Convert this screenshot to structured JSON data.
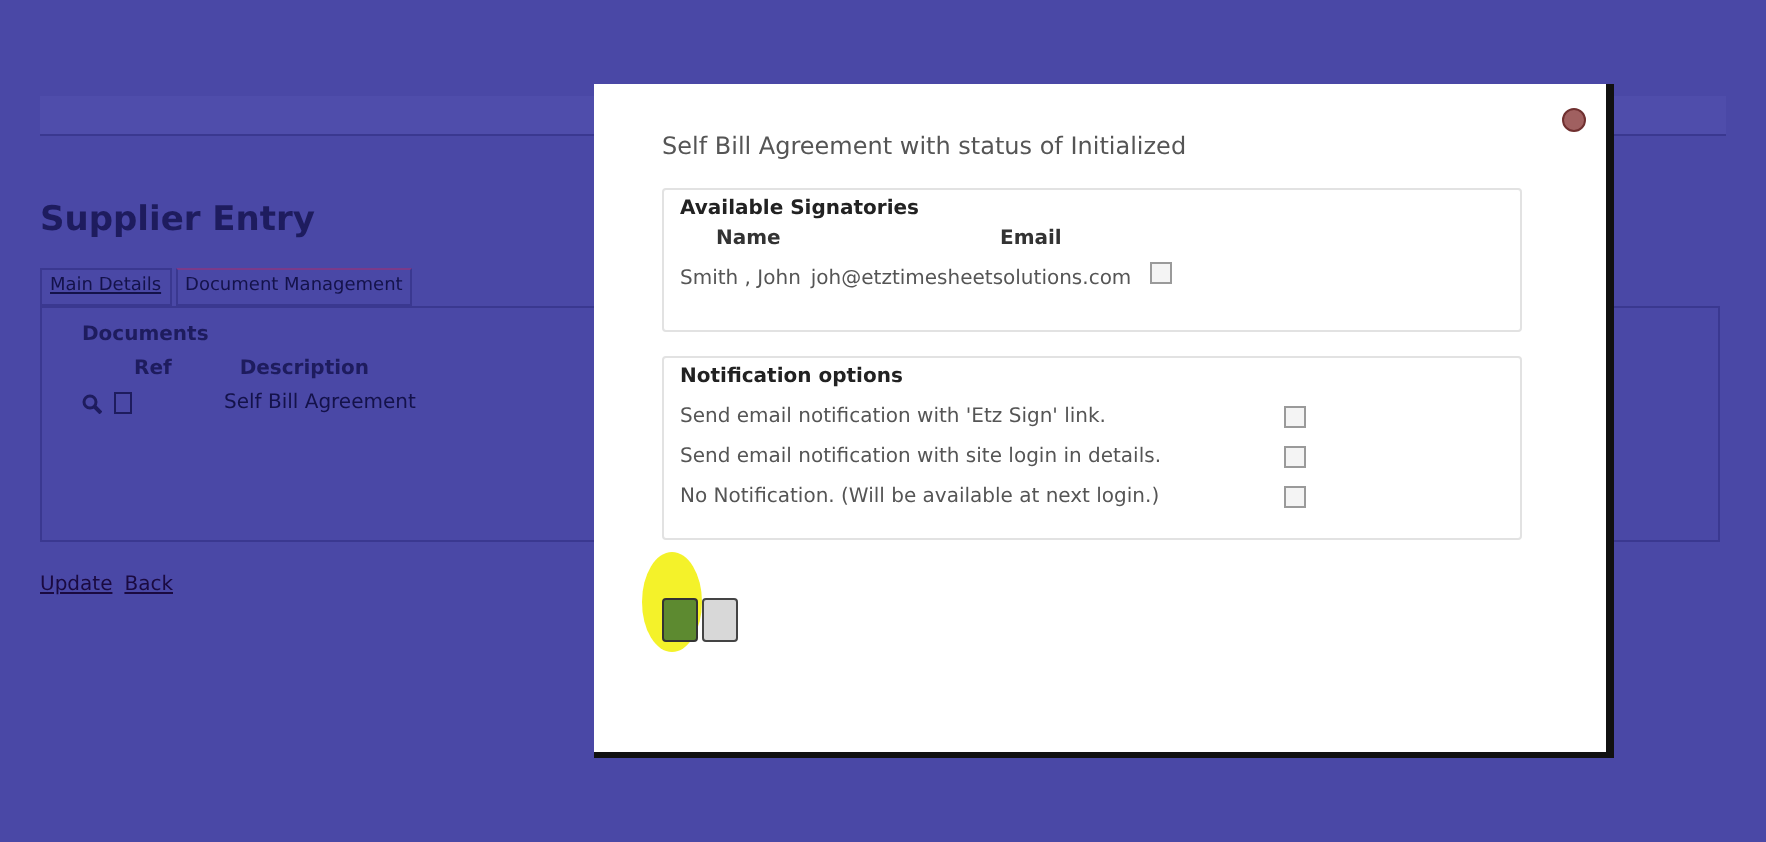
{
  "page": {
    "title": "Supplier Entry",
    "tabs": [
      {
        "label": "Main Details",
        "selected": false
      },
      {
        "label": "Document Management",
        "selected": true
      }
    ],
    "documents": {
      "heading": "Documents",
      "columns": [
        "Ref",
        "Description"
      ],
      "rows": [
        {
          "description": "Self Bill Agreement"
        }
      ]
    },
    "links": [
      "Update",
      "Back"
    ]
  },
  "dialog": {
    "title": "Self Bill Agreement with status of Initialized",
    "signatories": {
      "heading": "Available Signatories",
      "columns": [
        "Name",
        "Email"
      ],
      "rows": [
        {
          "name": "Smith , John",
          "email": "joh@etztimesheetsolutions.com",
          "checked": false
        }
      ]
    },
    "notifications": {
      "heading": "Notification options",
      "options": [
        {
          "label": "Send email notification with 'Etz Sign' link.",
          "checked": false
        },
        {
          "label": "Send email notification with site login in details.",
          "checked": false
        },
        {
          "label": "No Notification. (Will be available at next login.)",
          "checked": false
        }
      ]
    },
    "highlighted_action": true
  }
}
